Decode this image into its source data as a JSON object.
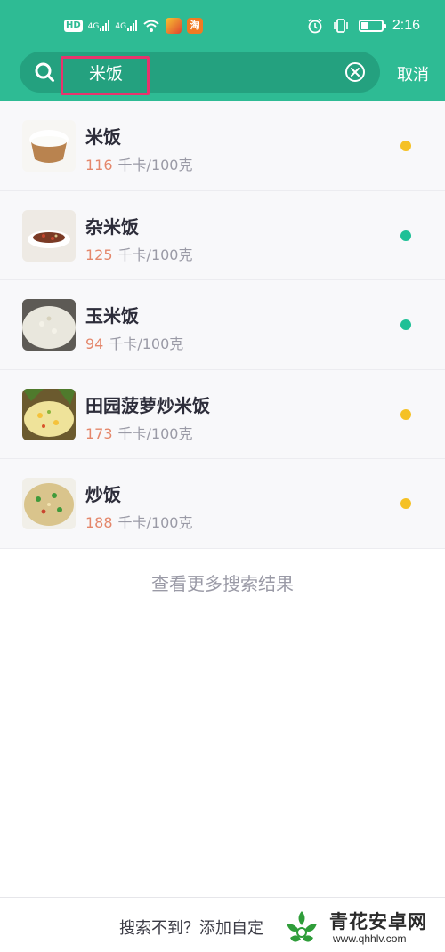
{
  "status_bar": {
    "hd_badge": "HD",
    "signal_1": "4G",
    "signal_2": "4G",
    "app_badge": "淘",
    "time": "2:16",
    "battery_level": 0.35
  },
  "search": {
    "query": "米饭",
    "cancel_label": "取消"
  },
  "results": [
    {
      "name": "米饭",
      "kcal": "116",
      "unit": "千卡/100克",
      "dot_color": "#f5c125"
    },
    {
      "name": "杂米饭",
      "kcal": "125",
      "unit": "千卡/100克",
      "dot_color": "#1fc096"
    },
    {
      "name": "玉米饭",
      "kcal": "94",
      "unit": "千卡/100克",
      "dot_color": "#1fc096"
    },
    {
      "name": "田园菠萝炒米饭",
      "kcal": "173",
      "unit": "千卡/100克",
      "dot_color": "#f5c125"
    },
    {
      "name": "炒饭",
      "kcal": "188",
      "unit": "千卡/100克",
      "dot_color": "#f5c125"
    }
  ],
  "more_results_label": "查看更多搜索结果",
  "bottom": {
    "add_label": "搜索不到？添加自定"
  },
  "watermark": {
    "title": "青花安卓网",
    "url": "www.qhhlv.com"
  },
  "colors": {
    "brand": "#2ebb94",
    "highlight_box": "#e8336d",
    "kcal_number": "#e4876b"
  }
}
